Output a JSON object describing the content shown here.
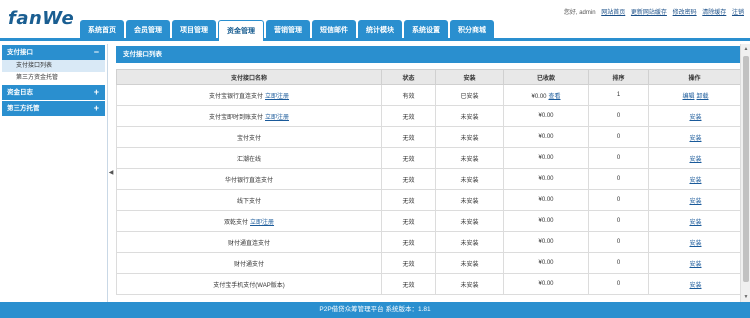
{
  "logo": "fanWe",
  "top_links": {
    "greeting": "您好, admin",
    "links": [
      "网站首页",
      "更新网站缓存",
      "修改密码",
      "清除缓存",
      "注销"
    ]
  },
  "nav_tabs": [
    "系统首页",
    "会员管理",
    "项目管理",
    "资金管理",
    "营销管理",
    "短信邮件",
    "统计模块",
    "系统设置",
    "积分商城"
  ],
  "sidebar": {
    "groups": [
      {
        "label": "支付接口",
        "toggle": "−",
        "items": [
          "支付接口列表",
          "第三方资金托管"
        ]
      },
      {
        "label": "资金日志",
        "toggle": "+"
      },
      {
        "label": "第三方托管",
        "toggle": "+"
      }
    ]
  },
  "panel_title": "支付接口列表",
  "table": {
    "headers": [
      "支付接口名称",
      "状态",
      "安装",
      "已收款",
      "排序",
      "操作"
    ],
    "rows": [
      {
        "name": "支付宝银行直连支付",
        "name_link": "立即注册",
        "status": "有效",
        "install": "已安装",
        "received": "¥0.00",
        "received_link": "查看",
        "sort": "1",
        "ops": [
          "编辑",
          "卸载"
        ]
      },
      {
        "name": "支付宝即时到账支付",
        "name_link": "立即注册",
        "status": "无效",
        "install": "未安装",
        "received": "¥0.00",
        "received_link": "",
        "sort": "0",
        "ops": [
          "安装"
        ]
      },
      {
        "name": "宝付支付",
        "name_link": "",
        "status": "无效",
        "install": "未安装",
        "received": "¥0.00",
        "received_link": "",
        "sort": "0",
        "ops": [
          "安装"
        ]
      },
      {
        "name": "汇潮在线",
        "name_link": "",
        "status": "无效",
        "install": "未安装",
        "received": "¥0.00",
        "received_link": "",
        "sort": "0",
        "ops": [
          "安装"
        ]
      },
      {
        "name": "华付银行直连支付",
        "name_link": "",
        "status": "无效",
        "install": "未安装",
        "received": "¥0.00",
        "received_link": "",
        "sort": "0",
        "ops": [
          "安装"
        ]
      },
      {
        "name": "线下支付",
        "name_link": "",
        "status": "无效",
        "install": "未安装",
        "received": "¥0.00",
        "received_link": "",
        "sort": "0",
        "ops": [
          "安装"
        ]
      },
      {
        "name": "双乾支付",
        "name_link": "立即注册",
        "status": "无效",
        "install": "未安装",
        "received": "¥0.00",
        "received_link": "",
        "sort": "0",
        "ops": [
          "安装"
        ]
      },
      {
        "name": "财付通直连支付",
        "name_link": "",
        "status": "无效",
        "install": "未安装",
        "received": "¥0.00",
        "received_link": "",
        "sort": "0",
        "ops": [
          "安装"
        ]
      },
      {
        "name": "财付通支付",
        "name_link": "",
        "status": "无效",
        "install": "未安装",
        "received": "¥0.00",
        "received_link": "",
        "sort": "0",
        "ops": [
          "安装"
        ]
      },
      {
        "name": "支付宝手机支付(WAP版本)",
        "name_link": "",
        "status": "无效",
        "install": "未安装",
        "received": "¥0.00",
        "received_link": "",
        "sort": "0",
        "ops": [
          "安装"
        ]
      }
    ]
  },
  "footer": "P2P借贷众筹管理平台 系统版本：1.81",
  "colors": {
    "accent": "#2a8fcf",
    "brand": "#1a5e91"
  },
  "icons": {
    "collapse": "triangle-left-icon",
    "scroll_up": "triangle-up-icon",
    "scroll_down": "triangle-down-icon"
  }
}
